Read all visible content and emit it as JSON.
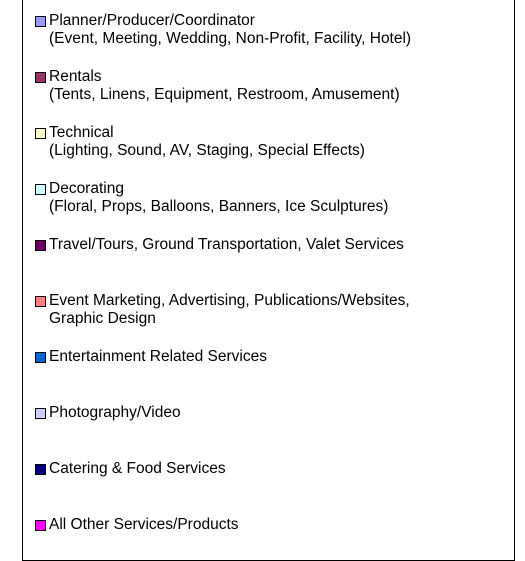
{
  "chart_data": {
    "type": "pie",
    "title": "",
    "legend_position": "right",
    "legend": [
      {
        "label": "Planner/Producer/Coordinator\n(Event, Meeting, Wedding, Non-Profit, Facility, Hotel)",
        "color": "#9999ff"
      },
      {
        "label": "Rentals\n(Tents, Linens, Equipment, Restroom, Amusement)",
        "color": "#993366"
      },
      {
        "label": "Technical\n(Lighting, Sound, AV, Staging, Special Effects)",
        "color": "#ffffcc"
      },
      {
        "label": "Decorating\n(Floral, Props, Balloons, Banners, Ice Sculptures)",
        "color": "#ccffff"
      },
      {
        "label": "Travel/Tours, Ground Transportation, Valet Services",
        "color": "#660066"
      },
      {
        "label": "Event Marketing, Advertising, Publications/Websites,\nGraphic Design",
        "color": "#ff8080"
      },
      {
        "label": "Entertainment Related Services",
        "color": "#0066cc"
      },
      {
        "label": "Photography/Video",
        "color": "#ccccff"
      },
      {
        "label": "Catering & Food Services",
        "color": "#000080"
      },
      {
        "label": "All Other Services/Products",
        "color": "#ff00ff"
      }
    ]
  }
}
